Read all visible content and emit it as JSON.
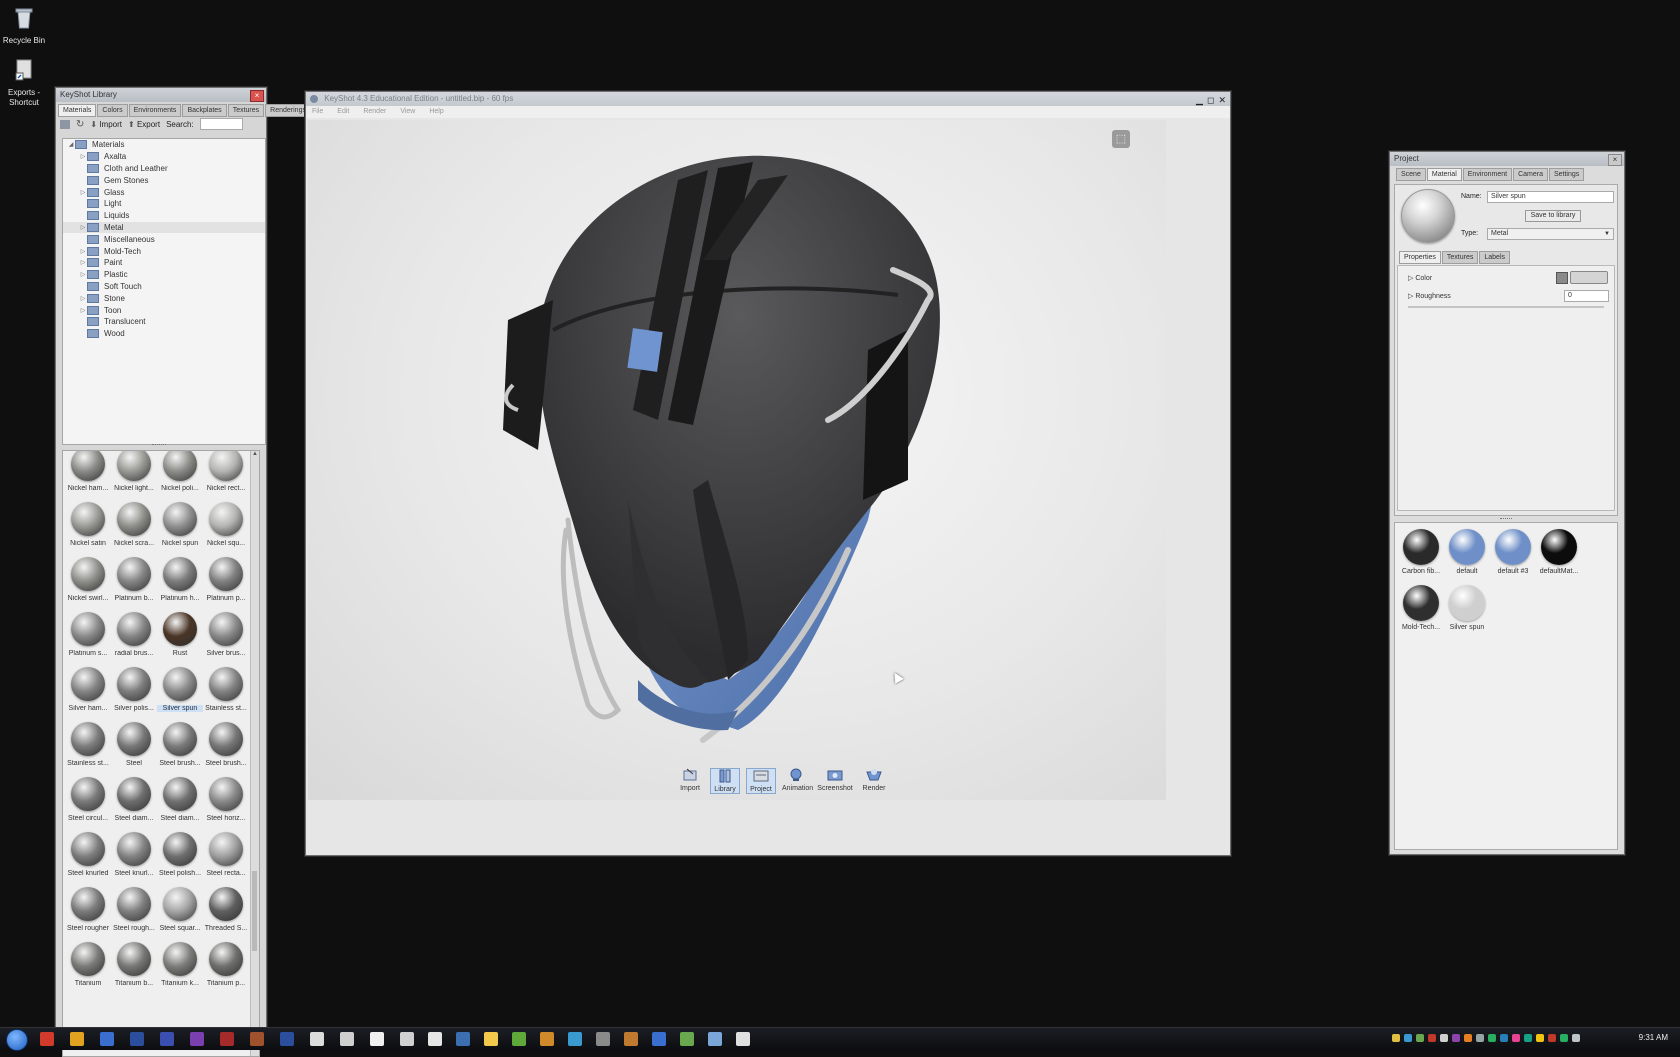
{
  "desktop": {
    "icons": [
      {
        "label": "Recycle Bin",
        "icon": "recycle-bin-icon"
      },
      {
        "label": "Exports - Shortcut",
        "icon": "shortcut-icon"
      }
    ]
  },
  "library": {
    "title": "KeyShot Library",
    "tabs": [
      "Materials",
      "Colors",
      "Environments",
      "Backplates",
      "Textures",
      "Renderings"
    ],
    "active_tab": "Materials",
    "toolbar": {
      "import_label": "Import",
      "export_label": "Export",
      "search_label": "Search:"
    },
    "tree_root": "Materials",
    "tree": [
      "Axalta",
      "Cloth and Leather",
      "Gem Stones",
      "Glass",
      "Light",
      "Liquids",
      "Metal",
      "Miscellaneous",
      "Mold-Tech",
      "Paint",
      "Plastic",
      "Soft Touch",
      "Stone",
      "Toon",
      "Translucent",
      "Wood"
    ],
    "selected_folder": "Metal",
    "thumbnails": [
      {
        "label": "Nickel ham...",
        "color": "#8a8a86"
      },
      {
        "label": "Nickel light...",
        "color": "#9a9a95"
      },
      {
        "label": "Nickel poli...",
        "color": "#8d8d89"
      },
      {
        "label": "Nickel rect...",
        "color": "#b5b5b3"
      },
      {
        "label": "Nickel satin",
        "color": "#9a9a96"
      },
      {
        "label": "Nickel scra...",
        "color": "#8e8e8a"
      },
      {
        "label": "Nickel spun",
        "color": "#909090"
      },
      {
        "label": "Nickel squ...",
        "color": "#b3b3b1"
      },
      {
        "label": "Nickel swirl...",
        "color": "#8f8f8b"
      },
      {
        "label": "Platinum b...",
        "color": "#868686"
      },
      {
        "label": "Platinum h...",
        "color": "#7c7c7c"
      },
      {
        "label": "Platinum p...",
        "color": "#808080"
      },
      {
        "label": "Platinum s...",
        "color": "#8a8a8a"
      },
      {
        "label": "radial brus...",
        "color": "#858585"
      },
      {
        "label": "Rust",
        "color": "#4a3526"
      },
      {
        "label": "Silver brus...",
        "color": "#8a8a8a"
      },
      {
        "label": "Silver ham...",
        "color": "#858585"
      },
      {
        "label": "Silver polis...",
        "color": "#7e7e7e"
      },
      {
        "label": "Silver spun",
        "color": "#8b8b8b"
      },
      {
        "label": "Stainless st...",
        "color": "#838383"
      },
      {
        "label": "Stainless st...",
        "color": "#7c7c7c"
      },
      {
        "label": "Steel",
        "color": "#777777"
      },
      {
        "label": "Steel brush...",
        "color": "#7a7a7a"
      },
      {
        "label": "Steel brush...",
        "color": "#777777"
      },
      {
        "label": "Steel circul...",
        "color": "#7a7a7a"
      },
      {
        "label": "Steel diam...",
        "color": "#6e6e6e"
      },
      {
        "label": "Steel diam...",
        "color": "#717171"
      },
      {
        "label": "Steel horiz...",
        "color": "#8a8a8a"
      },
      {
        "label": "Steel knurled",
        "color": "#7e7e7e"
      },
      {
        "label": "Steel knurl...",
        "color": "#838383"
      },
      {
        "label": "Steel polish...",
        "color": "#6f6f6f"
      },
      {
        "label": "Steel recta...",
        "color": "#a0a0a0"
      },
      {
        "label": "Steel rougher",
        "color": "#7b7b7b"
      },
      {
        "label": "Steel rough...",
        "color": "#808080"
      },
      {
        "label": "Steel squar...",
        "color": "#a6a6a6"
      },
      {
        "label": "Threaded S...",
        "color": "#5f5f5f"
      },
      {
        "label": "Titanium",
        "color": "#7a7a78"
      },
      {
        "label": "Titanium b...",
        "color": "#777775"
      },
      {
        "label": "Titanium k...",
        "color": "#7d7d7a"
      },
      {
        "label": "Titanium p...",
        "color": "#6f6f6d"
      }
    ],
    "selected_thumbnail": "Silver spun"
  },
  "main_window": {
    "title": "KeyShot 4.3 Educational Edition - untitled.bip - 60 fps",
    "menu": [
      "File",
      "Edit",
      "Render",
      "View",
      "Help"
    ],
    "toolbar": [
      "Import",
      "Library",
      "Project",
      "Animation",
      "Screenshot",
      "Render"
    ],
    "active_toolbar": [
      "Library",
      "Project"
    ]
  },
  "project": {
    "title": "Project",
    "tabs": [
      "Scene",
      "Material",
      "Environment",
      "Camera",
      "Settings"
    ],
    "active_tab": "Material",
    "name_label": "Name:",
    "name_value": "Silver spun",
    "save_label": "Save to library",
    "type_label": "Type:",
    "type_value": "Metal",
    "subtabs": [
      "Properties",
      "Textures",
      "Labels"
    ],
    "active_subtab": "Properties",
    "color_label": "Color",
    "roughness_label": "Roughness",
    "roughness_value": "0",
    "materials": [
      {
        "label": "Carbon fib...",
        "color": "#2a2a2a"
      },
      {
        "label": "default",
        "color": "#6e8fc7"
      },
      {
        "label": "default #3",
        "color": "#6e8fc7"
      },
      {
        "label": "defaultMat...",
        "color": "#0c0c0c"
      },
      {
        "label": "Mold-Tech...",
        "color": "#2f2f2f"
      },
      {
        "label": "Silver spun",
        "color": "#cfcfcf"
      }
    ]
  },
  "taskbar": {
    "clock": "9:31 AM"
  },
  "colors": {
    "accent": "#6e8fc7",
    "selection": "#cfe0f5"
  }
}
